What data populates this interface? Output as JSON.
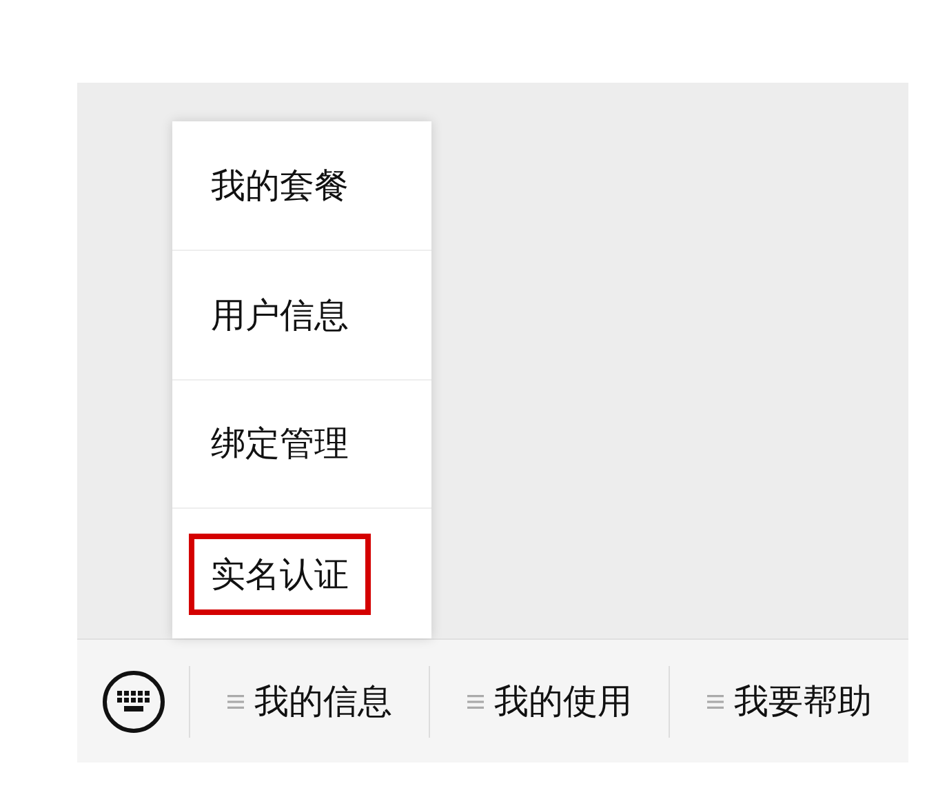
{
  "popup_menu": {
    "items": [
      {
        "label": "我的套餐",
        "highlighted": false
      },
      {
        "label": "用户信息",
        "highlighted": false
      },
      {
        "label": "绑定管理",
        "highlighted": false
      },
      {
        "label": "实名认证",
        "highlighted": true
      }
    ]
  },
  "bottom_menu": {
    "items": [
      {
        "label": "我的信息"
      },
      {
        "label": "我的使用"
      },
      {
        "label": "我要帮助"
      }
    ]
  }
}
